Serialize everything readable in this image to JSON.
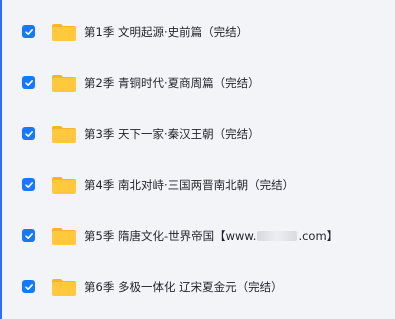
{
  "file_list": {
    "items": [
      {
        "checked": true,
        "icon": "folder-icon",
        "name": "第1季 文明起源·史前篇（完结）"
      },
      {
        "checked": true,
        "icon": "folder-icon",
        "name": "第2季 青铜时代·夏商周篇（完结）"
      },
      {
        "checked": true,
        "icon": "folder-icon",
        "name": "第3季 天下一家·秦汉王朝（完结）"
      },
      {
        "checked": true,
        "icon": "folder-icon",
        "name": "第4季 南北对峙·三国两晋南北朝（完结）"
      },
      {
        "checked": true,
        "icon": "folder-icon",
        "name_prefix": "第5季 隋唐文化-世界帝国【www.",
        "name_suffix": ".com】"
      },
      {
        "checked": true,
        "icon": "folder-icon",
        "name": "第6季 多极一体化 辽宋夏金元（完结）"
      }
    ]
  },
  "colors": {
    "background": "#f3f4f8",
    "checkbox": "#1677ff",
    "folder": "#ffc83d",
    "folder_tab": "#f4b52a",
    "text": "#1f2329",
    "accent_edge": "#2f6bff"
  }
}
